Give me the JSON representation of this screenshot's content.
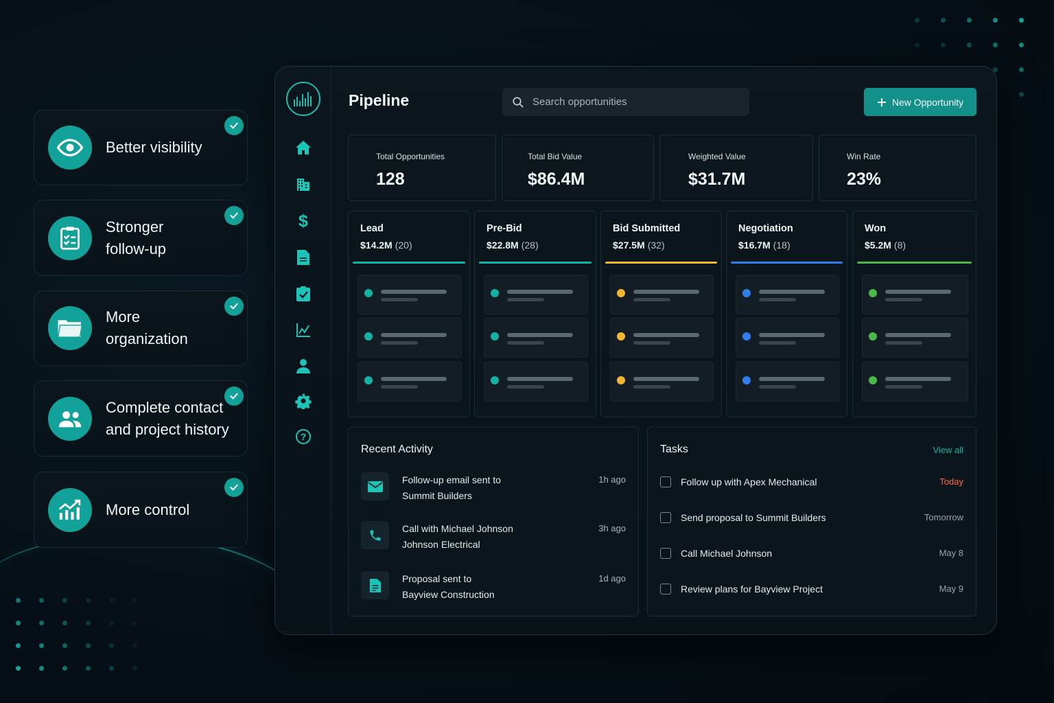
{
  "features": [
    {
      "label": "Better visibility",
      "icon": "eye-icon"
    },
    {
      "label": "Stronger\nfollow-up",
      "icon": "clipboard-icon"
    },
    {
      "label": "More\norganization",
      "icon": "folder-icon"
    },
    {
      "label": "Complete contact\nand project history",
      "icon": "users-icon"
    },
    {
      "label": "More control",
      "icon": "growth-chart-icon"
    }
  ],
  "header": {
    "title": "Pipeline",
    "search_placeholder": "Search opportunities",
    "new_button": "New Opportunity"
  },
  "sidebar": {
    "items": [
      "home-icon",
      "building-icon",
      "dollar-icon",
      "document-icon",
      "clipboard-check-icon",
      "analytics-icon",
      "user-icon",
      "settings-icon",
      "help-icon"
    ]
  },
  "stats": [
    {
      "label": "Total Opportunities",
      "value": "128"
    },
    {
      "label": "Total Bid Value",
      "value": "$86.4M"
    },
    {
      "label": "Weighted Value",
      "value": "$31.7M"
    },
    {
      "label": "Win Rate",
      "value": "23%"
    }
  ],
  "stages": [
    {
      "name": "Lead",
      "value": "$14.2M",
      "count": "(20)",
      "color": "#14b3a6"
    },
    {
      "name": "Pre-Bid",
      "value": "$22.8M",
      "count": "(28)",
      "color": "#14b3a6"
    },
    {
      "name": "Bid Submitted",
      "value": "$27.5M",
      "count": "(32)",
      "color": "#f2b632"
    },
    {
      "name": "Negotiation",
      "value": "$16.7M",
      "count": "(18)",
      "color": "#2f80ed"
    },
    {
      "name": "Won",
      "value": "$5.2M",
      "count": "(8)",
      "color": "#4cb84a"
    }
  ],
  "recent_activity": {
    "title": "Recent Activity",
    "items": [
      {
        "text": "Follow-up email sent to\nSummit Builders",
        "time": "1h ago",
        "icon": "mail-icon"
      },
      {
        "text": "Call with Michael Johnson\nJohnson Electrical",
        "time": "3h ago",
        "icon": "phone-icon"
      },
      {
        "text": "Proposal sent to\nBayview Construction",
        "time": "1d ago",
        "icon": "document-icon"
      }
    ]
  },
  "tasks": {
    "title": "Tasks",
    "view_all": "View all",
    "items": [
      {
        "text": "Follow up with Apex Mechanical",
        "due": "Today",
        "due_color": "#ff6b4a"
      },
      {
        "text": "Send proposal to Summit Builders",
        "due": "Tomorrow",
        "due_color": "#9aa6ab"
      },
      {
        "text": "Call Michael Johnson",
        "due": "May 8",
        "due_color": "#9aa6ab"
      },
      {
        "text": "Review plans for Bayview Project",
        "due": "May 9",
        "due_color": "#9aa6ab"
      }
    ]
  },
  "colors": {
    "accent": "#14a39a",
    "background": "#061017"
  }
}
